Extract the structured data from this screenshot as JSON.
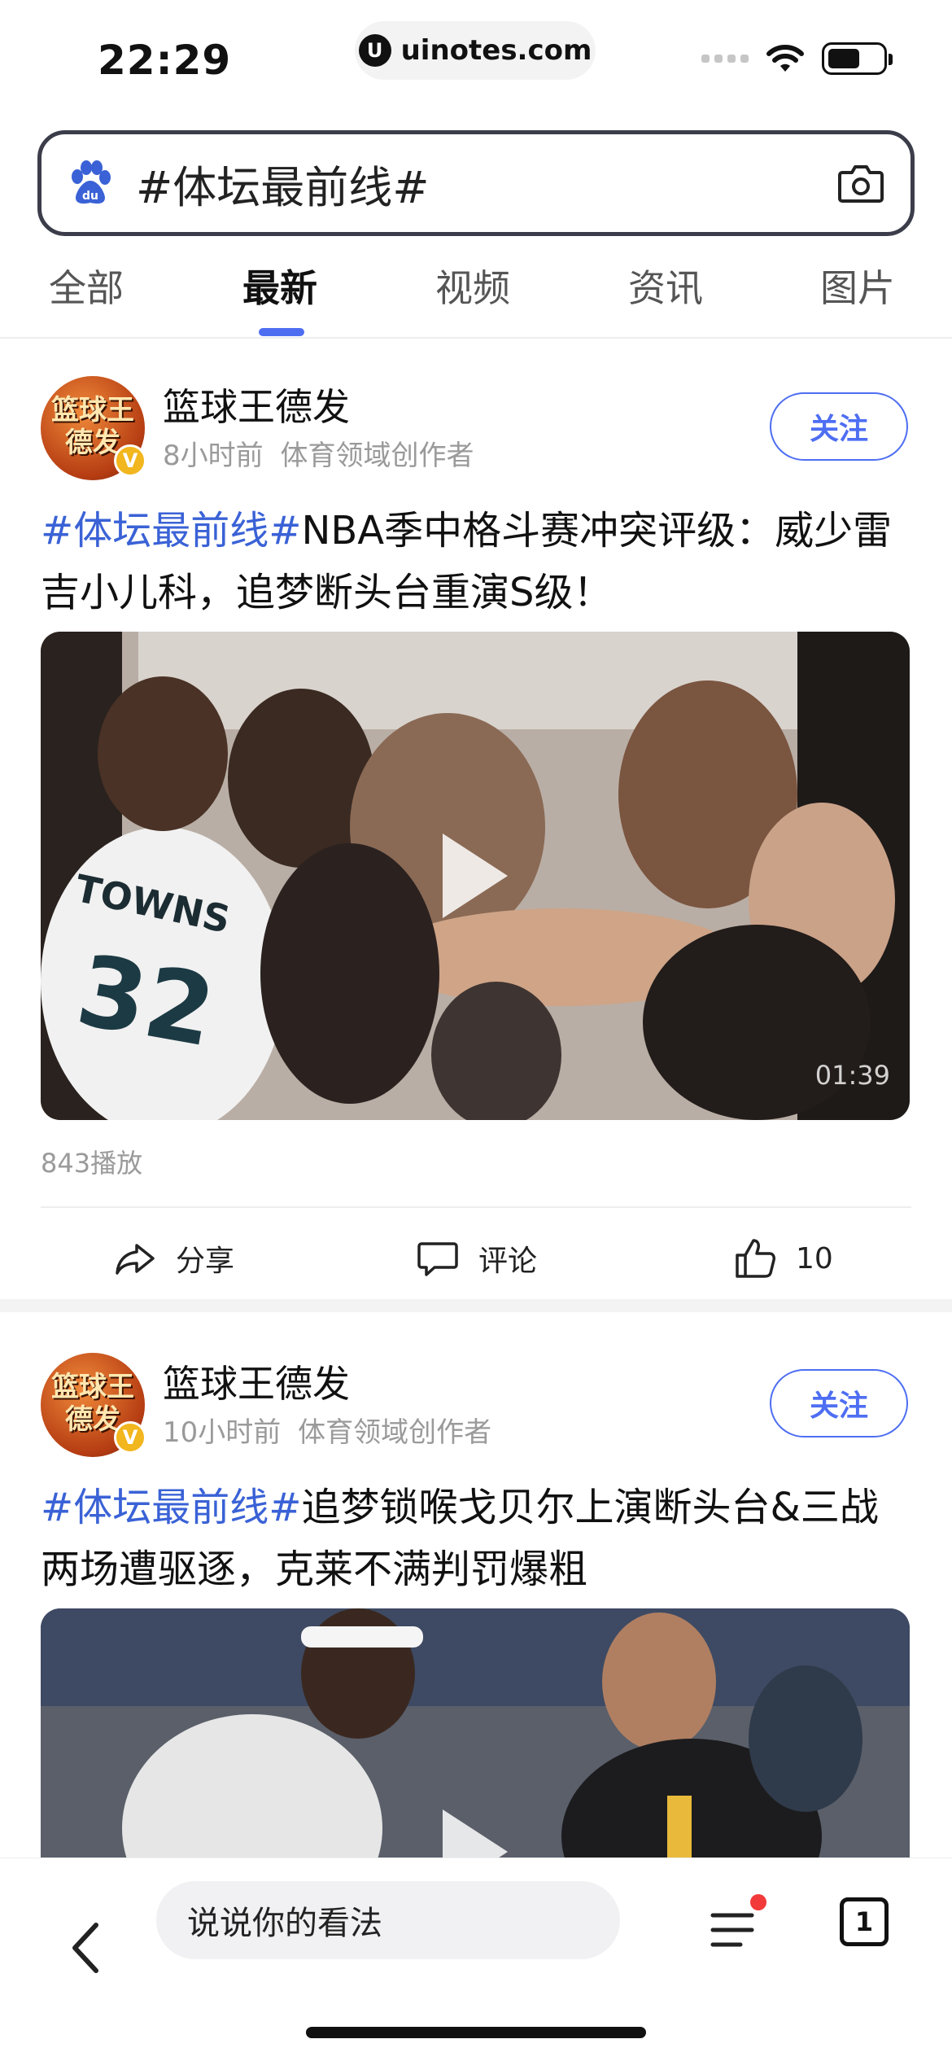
{
  "status_bar": {
    "time": "22:29",
    "site": "uinotes.com",
    "site_logo": "U"
  },
  "search": {
    "query": "#体坛最前线#"
  },
  "tabs": [
    {
      "label": "全部"
    },
    {
      "label": "最新"
    },
    {
      "label": "视频"
    },
    {
      "label": "资讯"
    },
    {
      "label": "图片"
    }
  ],
  "active_tab": "最新",
  "accent_color": "#4e6ef2",
  "cards": [
    {
      "avatar_text": "篮球王德发",
      "verified_mark": "V",
      "author": "篮球王德发",
      "time": "8小时前",
      "role": "体育领域创作者",
      "follow_label": "关注",
      "tag": "#体坛最前线#",
      "title": "NBA季中格斗赛冲突评级：威少雷吉小儿科，追梦断头台重演S级！",
      "duration": "01:39",
      "plays": "843播放",
      "share_label": "分享",
      "comment_label": "评论",
      "like_count": "10"
    },
    {
      "avatar_text": "篮球王德发",
      "verified_mark": "V",
      "author": "篮球王德发",
      "time": "10小时前",
      "role": "体育领域创作者",
      "follow_label": "关注",
      "tag": "#体坛最前线#",
      "title": "追梦锁喉戈贝尔上演断头台&三战两场遭驱逐，克莱不满判罚爆粗"
    }
  ],
  "bottom_bar": {
    "comment_placeholder": "说说你的看法",
    "tab_count": "1"
  }
}
